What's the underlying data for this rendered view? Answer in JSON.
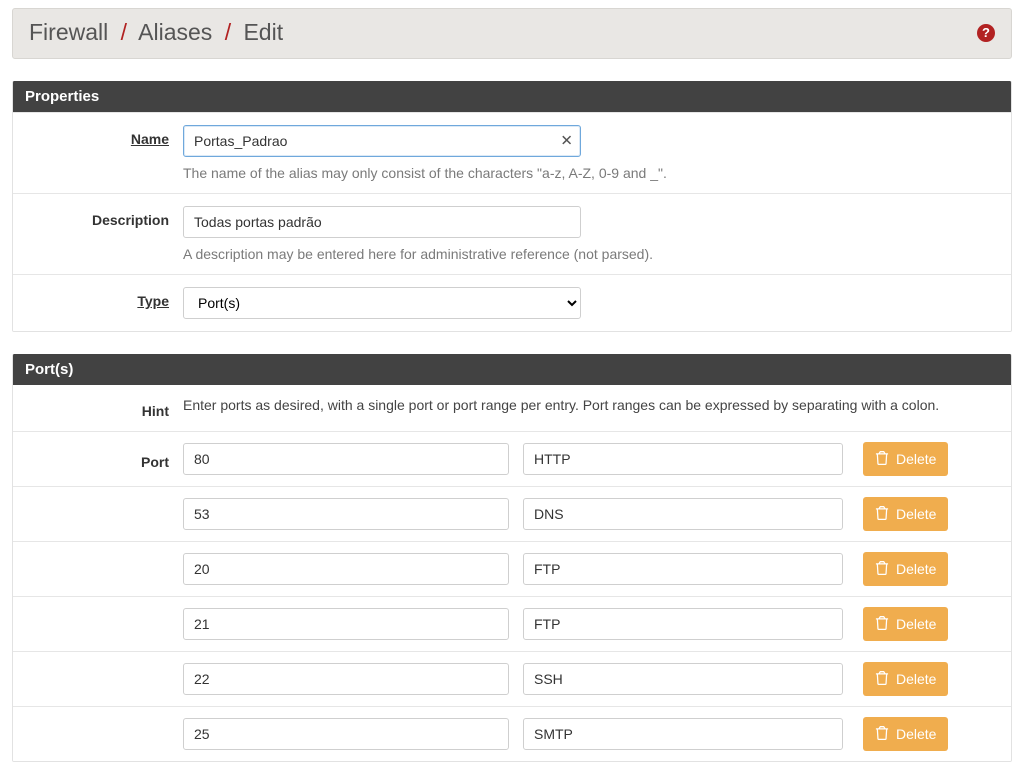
{
  "breadcrumbs": [
    "Firewall",
    "Aliases",
    "Edit"
  ],
  "panels": {
    "properties": {
      "title": "Properties",
      "name": {
        "label": "Name",
        "value": "Portas_Padrao",
        "help": "The name of the alias may only consist of the characters \"a-z, A-Z, 0-9 and _\"."
      },
      "description": {
        "label": "Description",
        "value": "Todas portas padrão",
        "help": "A description may be entered here for administrative reference (not parsed)."
      },
      "type": {
        "label": "Type",
        "selected": "Port(s)"
      }
    },
    "ports": {
      "title": "Port(s)",
      "hint_label": "Hint",
      "hint_text": "Enter ports as desired, with a single port or port range per entry. Port ranges can be expressed by separating with a colon.",
      "port_label": "Port",
      "delete_label": "Delete",
      "entries": [
        {
          "port": "80",
          "desc": "HTTP"
        },
        {
          "port": "53",
          "desc": "DNS"
        },
        {
          "port": "20",
          "desc": "FTP"
        },
        {
          "port": "21",
          "desc": "FTP"
        },
        {
          "port": "22",
          "desc": "SSH"
        },
        {
          "port": "25",
          "desc": "SMTP"
        }
      ]
    }
  }
}
